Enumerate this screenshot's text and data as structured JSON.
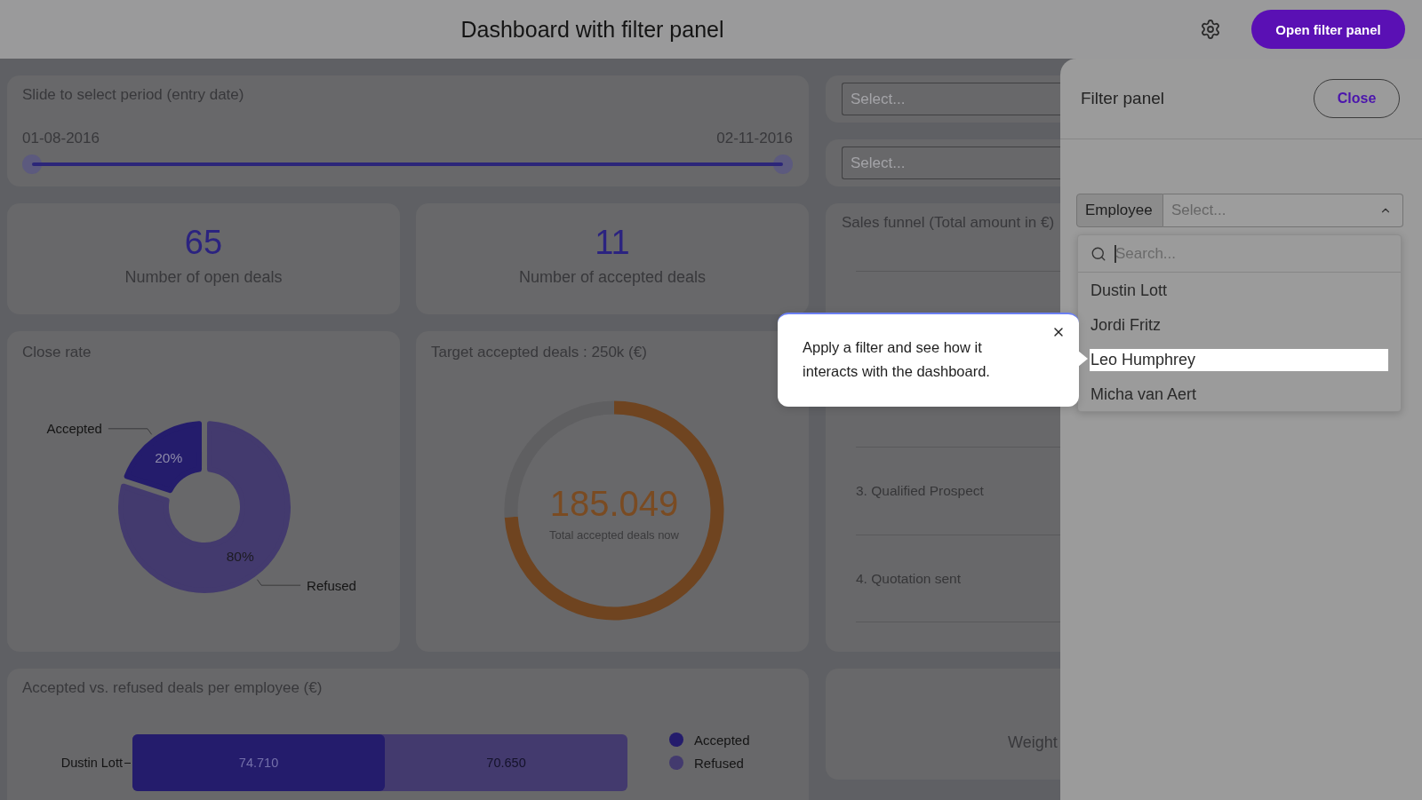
{
  "header": {
    "title": "Dashboard with filter panel",
    "button": "Open filter panel"
  },
  "period_slider": {
    "title": "Slide to select period (entry date)",
    "start_date": "01-08-2016",
    "end_date": "02-11-2016",
    "level": 1
  },
  "kpis": [
    {
      "value": "65",
      "label": "Number of open deals"
    },
    {
      "value": "11",
      "label": "Number of accepted deals"
    }
  ],
  "close_rate": {
    "title": "Close rate",
    "chart_data": {
      "type": "donut",
      "categories": [
        "Accepted",
        "Refused"
      ],
      "values": [
        20,
        80
      ],
      "value_labels": [
        "20%",
        "80%"
      ]
    }
  },
  "target": {
    "title": "Target accepted deals : 250k (€)",
    "value": "185.049",
    "caption": "Total accepted deals now",
    "chart_data": {
      "type": "donut",
      "values": [
        74,
        26
      ]
    }
  },
  "deals_per_employee": {
    "title": "Accepted vs. refused deals per employee (€)",
    "rows": [
      {
        "employee": "Dustin Lott",
        "accepted": "74.710",
        "refused": "70.650",
        "level": 0.51
      }
    ],
    "legend": [
      {
        "name": "Accepted",
        "color": "#241c6c"
      },
      {
        "name": "Refused",
        "color": "#433a6e"
      }
    ]
  },
  "filters": [
    {
      "placeholder": "Select..."
    },
    {
      "placeholder": "Select..."
    }
  ],
  "sales_funnel": {
    "title": "Sales funnel (Total amount in €)",
    "stages": [
      "3. Qualified Prospect",
      "4. Quotation sent"
    ]
  },
  "weighted_card": {
    "label": "Weight"
  },
  "filter_panel": {
    "title": "Filter panel",
    "close_button": "Close",
    "employee_select": {
      "label": "Employee",
      "placeholder": "Select...",
      "expanded": true,
      "search": {
        "placeholder": "Search...",
        "focused": true
      },
      "options": [
        {
          "label": "Dustin Lott",
          "highlighted": false
        },
        {
          "label": "Jordi Fritz",
          "highlighted": false
        },
        {
          "label": "Leo Humphrey",
          "highlighted": true
        },
        {
          "label": "Micha van Aert",
          "highlighted": false
        }
      ]
    }
  },
  "tour_tooltip": {
    "text": "Apply a filter and see how it interacts with the dashboard."
  }
}
